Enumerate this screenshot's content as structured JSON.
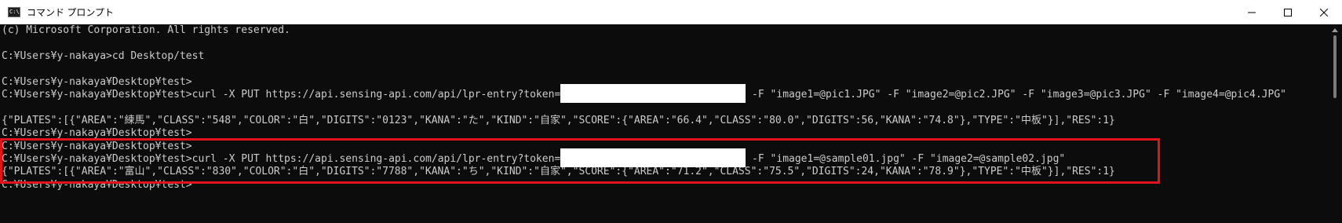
{
  "window": {
    "title": "コマンド プロンプト",
    "icon": "cmd-icon",
    "controls": [
      "minimize-icon",
      "maximize-icon",
      "close-icon"
    ]
  },
  "console": {
    "lines": [
      {
        "text": "(c) Microsoft Corporation. All rights reserved."
      },
      {
        "text": ""
      },
      {
        "text": "C:¥Users¥y-nakaya>cd Desktop/test"
      },
      {
        "text": ""
      },
      {
        "text": "C:¥Users¥y-nakaya¥Desktop¥test>"
      },
      {
        "text": "C:¥Users¥y-nakaya¥Desktop¥test>curl -X PUT https://api.sensing-api.com/api/lpr-entry?token=",
        "after": " -F \"image1=@pic1.JPG\" -F \"image2=@pic2.JPG\" -F \"image3=@pic3.JPG\" -F \"image4=@pic4.JPG\""
      },
      {
        "text": ""
      },
      {
        "text": "{\"PLATES\":[{\"AREA\":\"練馬\",\"CLASS\":\"548\",\"COLOR\":\"白\",\"DIGITS\":\"0123\",\"KANA\":\"た\",\"KIND\":\"自家\",\"SCORE\":{\"AREA\":\"66.4\",\"CLASS\":\"80.0\",\"DIGITS\":56,\"KANA\":\"74.8\"},\"TYPE\":\"中板\"}],\"RES\":1}"
      },
      {
        "text": "C:¥Users¥y-nakaya¥Desktop¥test>"
      },
      {
        "text": "C:¥Users¥y-nakaya¥Desktop¥test>"
      },
      {
        "text": "C:¥Users¥y-nakaya¥Desktop¥test>curl -X PUT https://api.sensing-api.com/api/lpr-entry?token=",
        "after": " -F \"image1=@sample01.jpg\" -F \"image2=@sample02.jpg\""
      },
      {
        "text": "{\"PLATES\":[{\"AREA\":\"富山\",\"CLASS\":\"830\",\"COLOR\":\"白\",\"DIGITS\":\"7788\",\"KANA\":\"ち\",\"KIND\":\"自家\",\"SCORE\":{\"AREA\":\"71.2\",\"CLASS\":\"75.5\",\"DIGITS\":24,\"KANA\":\"78.9\"},\"TYPE\":\"中板\"}],\"RES\":1}"
      },
      {
        "text": "C:¥Users¥y-nakaya¥Desktop¥test>"
      }
    ]
  },
  "colors": {
    "console_bg": "#0c0c0c",
    "console_text": "#cccccc",
    "highlight": "#e0141d",
    "redaction": "#ffffff"
  }
}
